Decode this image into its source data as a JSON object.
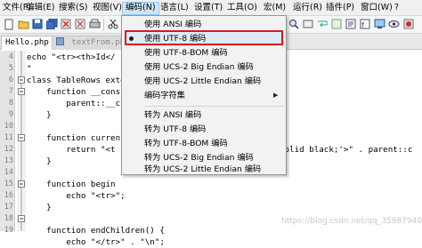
{
  "menubar": [
    {
      "label": "文件(F)"
    },
    {
      "label": "编辑(E)"
    },
    {
      "label": "搜索(S)"
    },
    {
      "label": "视图(V)"
    },
    {
      "label": "编码(N)"
    },
    {
      "label": "语言(L)"
    },
    {
      "label": "设置(T)"
    },
    {
      "label": "工具(O)"
    },
    {
      "label": "宏(M)"
    },
    {
      "label": "运行(R)"
    },
    {
      "label": "插件(P)"
    },
    {
      "label": "窗口(W)"
    },
    {
      "label": "?"
    }
  ],
  "tabs": [
    {
      "label": "Hello.php"
    },
    {
      "label": "textFrom.php"
    }
  ],
  "code_lines": [
    {
      "num": "4",
      "text": "echo \"<tr><th>Id</"
    },
    {
      "num": "5",
      "text": "\""
    },
    {
      "num": "6",
      "text": "class TableRows exte"
    },
    {
      "num": "7",
      "text": "    function __cons"
    },
    {
      "num": "8",
      "text": "        parent::__c"
    },
    {
      "num": "9",
      "text": "    }"
    },
    {
      "num": "10",
      "text": ""
    },
    {
      "num": "11",
      "text": "    function curren"
    },
    {
      "num": "12",
      "text": "        return \"<t"
    },
    {
      "num": "13",
      "text": "    }"
    },
    {
      "num": "14",
      "text": ""
    },
    {
      "num": "15",
      "text": "    function begin"
    },
    {
      "num": "16",
      "text": "        echo \"<tr>\";"
    },
    {
      "num": "17",
      "text": "    }"
    },
    {
      "num": "18",
      "text": ""
    },
    {
      "num": "19",
      "text": "    function endChildren() {"
    },
    {
      "num": "20",
      "text": "        echo \"</tr>\" . \"\\n\";"
    }
  ],
  "code_right_fragment": "solid black;'>\" . parent::c",
  "dropdown": {
    "items": [
      {
        "label": "使用 ANSI 编码"
      },
      {
        "label": "使用 UTF-8 编码",
        "checked": true
      },
      {
        "label": "使用 UTF-8-BOM 编码"
      },
      {
        "label": "使用 UCS-2 Big Endian 编码"
      },
      {
        "label": "使用 UCS-2 Little Endian 编码"
      },
      {
        "label": "编码字符集",
        "submenu": true
      },
      {
        "label": "转为 ANSI 编码"
      },
      {
        "label": "转为 UTF-8 编码"
      },
      {
        "label": "转为 UTF-8-BOM 编码"
      },
      {
        "label": "转为 UCS-2 Big Endian 编码"
      },
      {
        "label": "转为 UCS-2 Little Endian 编码"
      }
    ],
    "submenu_arrow": "▶"
  },
  "watermark": "https://blog.csdn.net/qq_35987940",
  "colors": {
    "highlight_border": "#e0141e",
    "keyword": "#00007f"
  },
  "toolbar_icons": [
    "new-file-icon",
    "open-icon",
    "save-icon",
    "save-all-icon",
    "close-icon",
    "close-all-icon",
    "print-icon",
    "cut-icon",
    "copy-icon",
    "paste-icon",
    "undo-icon",
    "redo-icon",
    "find-icon",
    "replace-icon",
    "zoom-in-icon",
    "zoom-out-icon",
    "sync-v-icon",
    "sync-h-icon",
    "wrap-icon",
    "indent-guide-icon",
    "doc-map-icon",
    "function-list-icon",
    "folder-workspace-icon",
    "monitor-icon",
    "record-macro-icon"
  ]
}
